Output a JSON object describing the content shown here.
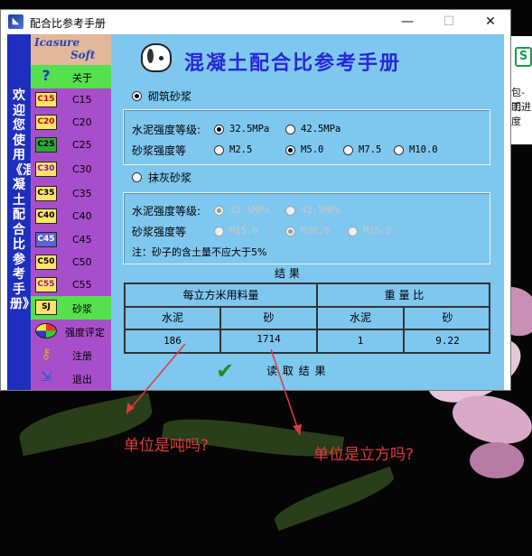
{
  "window": {
    "title": "配合比参考手册",
    "controls": {
      "minimize": "—",
      "maximize": "☐",
      "close": "✕"
    }
  },
  "banner": {
    "text": "欢迎您使用《混凝土配合比参考手册》！"
  },
  "logo": {
    "line1": "Icasure",
    "line2": "Soft"
  },
  "sidebar": {
    "items": [
      {
        "icon": "?",
        "label": "关于",
        "active": true
      },
      {
        "icon": "C15",
        "label": "C15"
      },
      {
        "icon": "C20",
        "label": "C20"
      },
      {
        "icon": "C25",
        "label": "C25"
      },
      {
        "icon": "C30",
        "label": "C30"
      },
      {
        "icon": "C35",
        "label": "C35"
      },
      {
        "icon": "C40",
        "label": "C40"
      },
      {
        "icon": "C45",
        "label": "C45"
      },
      {
        "icon": "C50",
        "label": "C50"
      },
      {
        "icon": "C55",
        "label": "C55"
      },
      {
        "icon": "SJ",
        "label": "砂浆",
        "active": true
      },
      {
        "icon": "",
        "label": "强度评定"
      },
      {
        "icon": "",
        "label": "注册"
      },
      {
        "icon": "",
        "label": "退出"
      }
    ]
  },
  "header": {
    "title": "混凝土配合比参考手册"
  },
  "masonry": {
    "label": "砌筑砂浆",
    "cement_label": "水泥强度等级:",
    "cement_options": [
      "32.5MPa",
      "42.5MPa"
    ],
    "mortar_label": "砂浆强度等",
    "mortar_options": [
      "M2.5",
      "M5.0",
      "M7.5",
      "M10.0"
    ]
  },
  "plaster": {
    "label": "抹灰砂浆",
    "cement_label": "水泥强度等级:",
    "cement_options": [
      "32.5MPa",
      "42.5MPa"
    ],
    "mortar_label": "砂浆强度等",
    "mortar_options": [
      "M15.0",
      "M20.0",
      "M25.0"
    ],
    "note": "注：砂子的含土量不应大于5%"
  },
  "results": {
    "title": "结    果",
    "header_left": "每立方米用料量",
    "header_right": "重  量  比",
    "col_cement": "水泥",
    "col_sand": "砂",
    "col_cement2": "水泥",
    "col_sand2": "砂",
    "cement_value": "186",
    "sand_value": "1714",
    "ratio_cement": "1",
    "ratio_sand": "9.22"
  },
  "read_button": {
    "label": "读 取 结 果"
  },
  "annotations": {
    "left": "单位是吨吗?",
    "right": "单位是立方吗?"
  },
  "desktop_right": {
    "icon_letter": "S",
    "text1": "包-工",
    "text2": "明进度"
  }
}
